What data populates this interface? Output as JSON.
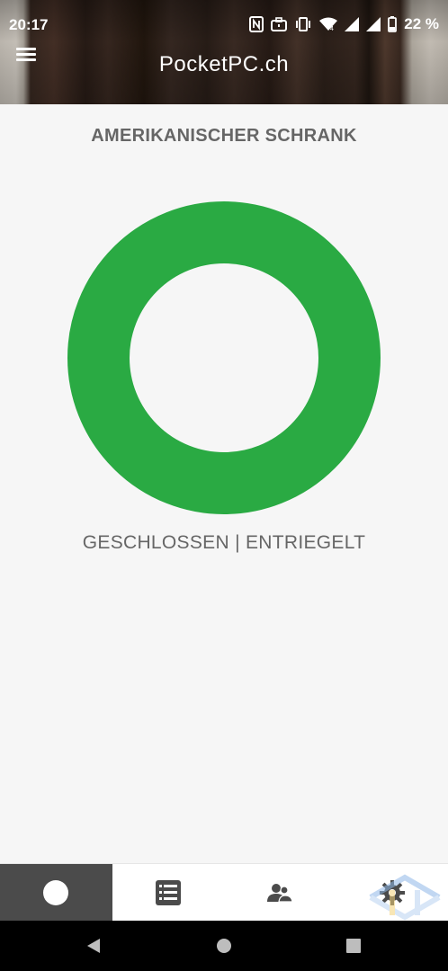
{
  "status_bar": {
    "time": "20:17",
    "battery": "22 %",
    "icons": [
      "nfc-icon",
      "briefcase-icon",
      "vibrate-icon",
      "wifi-icon",
      "signal-icon",
      "signal-icon",
      "battery-icon"
    ]
  },
  "header": {
    "title": "PocketPC.ch",
    "menu_icon": "hamburger-menu-icon"
  },
  "main": {
    "device_name": "AMERIKANISCHER SCHRANK",
    "status_text": "GESCHLOSSEN | ENTRIEGELT",
    "ring_color": "#2aaa43"
  },
  "bottom_nav": {
    "items": [
      {
        "icon": "circle-status-icon",
        "active": true
      },
      {
        "icon": "list-icon",
        "active": false
      },
      {
        "icon": "users-icon",
        "active": false
      },
      {
        "icon": "gear-icon",
        "active": false
      }
    ]
  },
  "system_nav": {
    "buttons": [
      "back-icon",
      "home-icon",
      "recents-icon"
    ]
  },
  "colors": {
    "accent_green": "#2aaa43",
    "text_gray": "#666666",
    "active_nav_bg": "#4b4b4b"
  }
}
